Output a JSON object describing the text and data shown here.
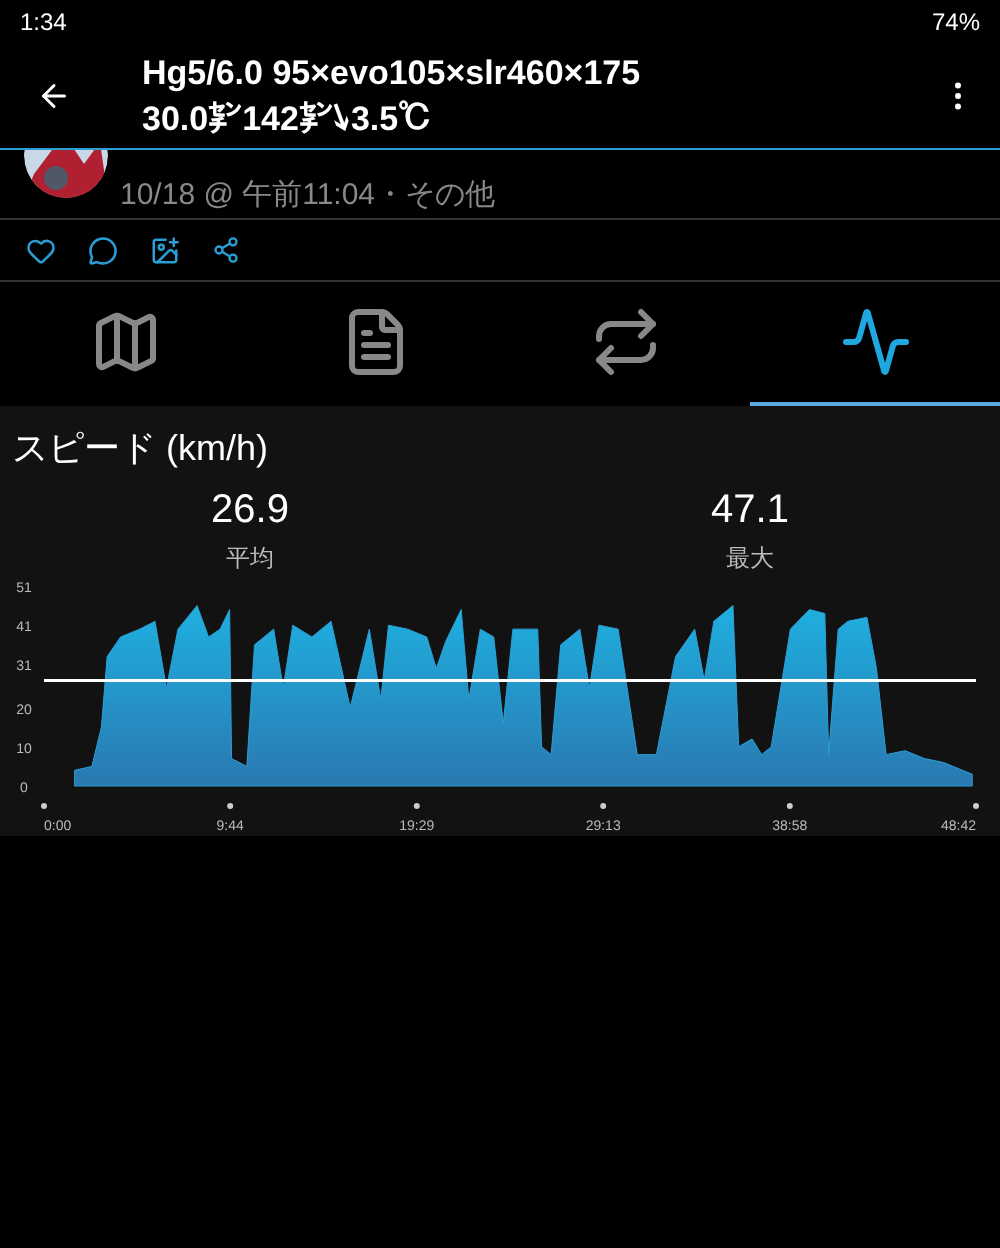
{
  "status_bar": {
    "time": "1:34",
    "battery": "74%"
  },
  "header": {
    "title": "Hg5/6.0 95×evo105×slr460×175",
    "subtitle": "30.0㌢142㌢↘3.5℃"
  },
  "post": {
    "meta": "10/18 @ 午前11:04・その他"
  },
  "tabs": [
    {
      "kind": "map",
      "selected": false
    },
    {
      "kind": "details",
      "selected": false
    },
    {
      "kind": "laps",
      "selected": false
    },
    {
      "kind": "chart",
      "selected": true
    }
  ],
  "section": {
    "title": "スピード (km/h)",
    "stats": [
      {
        "value": "26.9",
        "label": "平均"
      },
      {
        "value": "47.1",
        "label": "最大"
      }
    ],
    "chart_data": {
      "type": "area",
      "x": [
        1.6,
        2.5,
        3.0,
        3.3,
        4,
        5,
        5.8,
        6.4,
        7,
        8,
        8.6,
        9.2,
        9.7,
        9.8,
        10.6,
        11,
        12,
        12.5,
        13,
        14,
        15,
        16,
        17,
        17.6,
        18,
        19,
        20,
        20.5,
        21,
        21.8,
        22.2,
        22.8,
        23.5,
        24,
        24.5,
        25.8,
        26,
        26.5,
        27,
        28,
        28.5,
        29,
        30,
        31,
        32,
        33,
        34,
        34.5,
        35,
        36,
        36.3,
        37,
        37.5,
        38,
        39,
        40,
        40.8,
        41,
        41.5,
        42,
        43,
        43.5,
        44,
        45,
        46,
        47,
        48,
        48.5
      ],
      "series": [
        {
          "color": "#2a9fd6",
          "values": [
            4,
            5,
            15,
            33,
            38,
            40,
            42,
            25,
            40,
            46,
            38,
            40,
            45,
            7,
            5,
            36,
            40,
            25,
            41,
            38,
            42,
            20,
            40,
            22,
            41,
            40,
            38,
            30,
            37,
            45,
            22,
            40,
            38,
            16,
            40,
            40,
            10,
            8,
            36,
            40,
            25,
            41,
            40,
            8,
            8,
            33,
            40,
            27,
            42,
            46,
            10,
            12,
            8,
            10,
            40,
            45,
            44,
            8,
            40,
            42,
            43,
            30,
            8,
            9,
            7,
            6,
            4,
            3
          ]
        }
      ],
      "xlim": [
        0,
        48.7
      ],
      "ylim": [
        0,
        51
      ],
      "xticks": [
        {
          "value": 0,
          "label": "0:00"
        },
        {
          "value": 9.73,
          "label": "9:44"
        },
        {
          "value": 19.48,
          "label": "19:29"
        },
        {
          "value": 29.22,
          "label": "29:13"
        },
        {
          "value": 38.97,
          "label": "38:58"
        },
        {
          "value": 48.7,
          "label": "48:42"
        }
      ],
      "yticks": [
        0,
        10,
        20,
        31,
        41,
        51
      ],
      "ref_lines": [
        {
          "axis": "y",
          "value": 26.9
        }
      ]
    }
  }
}
